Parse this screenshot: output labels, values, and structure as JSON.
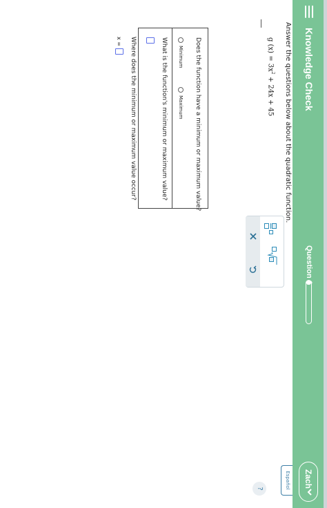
{
  "header": {
    "title": "Knowledge Check",
    "question_label": "Question 1",
    "progress_fraction": 0.1,
    "user_name": "Zach",
    "language_link": "Español",
    "help_glyph": "?"
  },
  "colors": {
    "header_bg": "#7ac496",
    "accent_teal": "#2a8bb8",
    "answer_box_border": "#5a6ee8",
    "language_link": "#3c7ea6"
  },
  "problem": {
    "prompt": "Answer the questions below about the quadratic function.",
    "function_lhs": "g (x) = 3x",
    "function_exponent": "2",
    "function_rhs": " + 24x + 45"
  },
  "questions": {
    "q1_text": "Does the function have a minimum or maximum value?",
    "q1_options": [
      "Minimum",
      "Maximum"
    ],
    "q2_text": "What is the function's minimum or maximum value?",
    "q3_text": "Where does the minimum or maximum value occur?",
    "q3_prefix": "x ="
  },
  "toolbar": {
    "icons": [
      "fraction-icon",
      "mixed-square-root-icon",
      "clear-x-icon",
      "undo-icon"
    ]
  }
}
